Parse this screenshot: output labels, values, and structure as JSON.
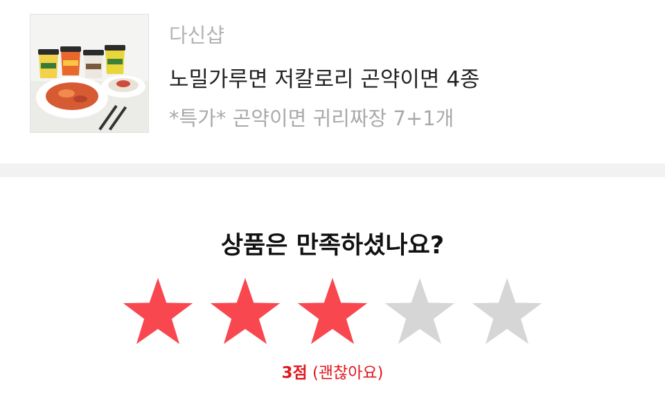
{
  "product": {
    "seller": "다신샵",
    "name": "노밀가루면 저칼로리 곤약이면 4종",
    "option": "*특가* 곤약이면 귀리짜장 7+1개",
    "image_alt": "곤약이면 4종 제품 사진"
  },
  "review": {
    "question": "상품은 만족하셨나요?",
    "rating": 3,
    "max_rating": 5,
    "score_label": "3점",
    "score_desc": "(괜찮아요)"
  },
  "colors": {
    "star_active": "#f9474f",
    "star_inactive": "#d6d6d6",
    "score_text": "#e0191f",
    "divider": "#f2f2f2"
  }
}
